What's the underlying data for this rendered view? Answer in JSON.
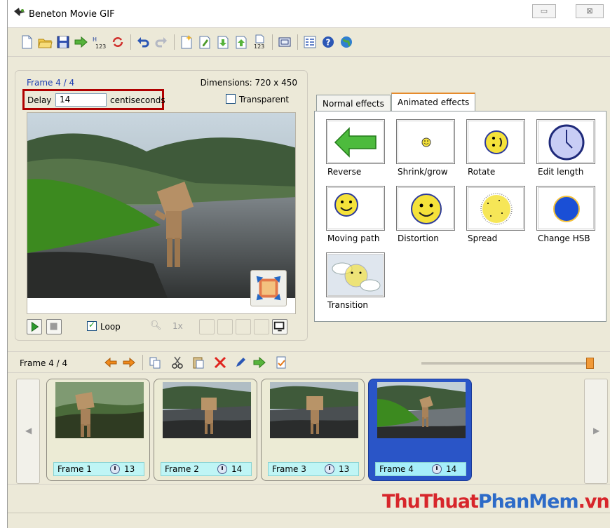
{
  "window": {
    "title": "Beneton Movie GIF",
    "minimize_label": "▭",
    "close_label": "⊠"
  },
  "toolbar": {
    "icons": [
      "new-file-icon",
      "open-folder-icon",
      "save-icon",
      "export-icon",
      "numbering-icon",
      "reload-icon",
      "undo-icon",
      "redo-icon",
      "add-frame-icon",
      "edit-frame-icon",
      "import-frame-icon",
      "export-frame-icon",
      "renumber-icon",
      "fit-screen-icon",
      "properties-icon",
      "help-icon",
      "web-icon"
    ]
  },
  "frame_panel": {
    "frame_label": "Frame 4 / 4",
    "dimensions": "Dimensions: 720 x 450",
    "delay_label": "Delay",
    "delay_value": "14",
    "delay_unit": "centiseconds",
    "transparent_label": "Transparent",
    "transparent_checked": false,
    "loop_label": "Loop",
    "loop_checked": true,
    "zoom_level": "1x"
  },
  "effects": {
    "tabs": [
      {
        "label": "Normal effects",
        "active": false
      },
      {
        "label": "Animated effects",
        "active": true
      }
    ],
    "items": [
      {
        "label": "Reverse",
        "icon": "reverse-arrow-icon"
      },
      {
        "label": "Shrink/grow",
        "icon": "small-smiley-icon"
      },
      {
        "label": "Rotate",
        "icon": "rotated-smiley-icon"
      },
      {
        "label": "Edit length",
        "icon": "clock-icon"
      },
      {
        "label": "Moving path",
        "icon": "smiley-icon"
      },
      {
        "label": "Distortion",
        "icon": "large-smiley-icon"
      },
      {
        "label": "Spread",
        "icon": "spread-dots-icon"
      },
      {
        "label": "Change HSB",
        "icon": "blue-circle-icon"
      },
      {
        "label": "Transition",
        "icon": "transition-icon"
      }
    ]
  },
  "strip": {
    "label": "Frame 4 / 4",
    "slider_value": 1.0,
    "frames": [
      {
        "name": "Frame 1",
        "delay": "13",
        "selected": false
      },
      {
        "name": "Frame 2",
        "delay": "14",
        "selected": false
      },
      {
        "name": "Frame 3",
        "delay": "13",
        "selected": false
      },
      {
        "name": "Frame 4",
        "delay": "14",
        "selected": true
      }
    ]
  },
  "watermark": {
    "part1": "ThuThuat",
    "part2": "PhanMem",
    "part3": ".vn"
  }
}
